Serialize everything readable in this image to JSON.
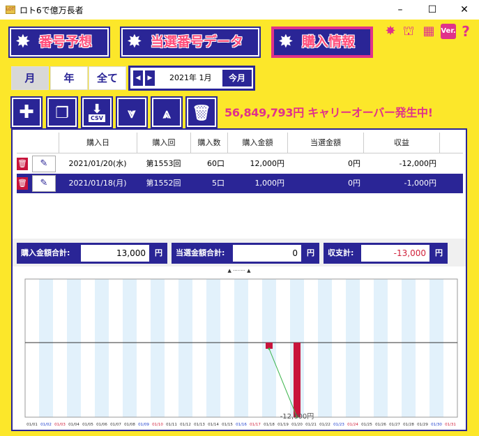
{
  "window": {
    "title": "ロト6で億万長者",
    "minimize": "–",
    "maximize": "☐",
    "close": "✕"
  },
  "nav": {
    "tabs": [
      {
        "label": "番号予想",
        "active": false
      },
      {
        "label": "当選番号データ",
        "active": false
      },
      {
        "label": "購入情報",
        "active": true
      }
    ],
    "version_label": "Ver.",
    "help_label": "?"
  },
  "period": {
    "buttons": [
      {
        "label": "月",
        "active": true
      },
      {
        "label": "年",
        "active": false
      },
      {
        "label": "全て",
        "active": false
      }
    ],
    "current": "2021年 1月",
    "today_label": "今月"
  },
  "toolbar": {
    "csv_label": "CSV",
    "carryover_text": "56,849,793円 キャリーオーバー発生中!"
  },
  "table": {
    "headers": [
      "購入日",
      "購入回",
      "購入数",
      "購入金額",
      "当選金額",
      "収益"
    ],
    "rows": [
      {
        "date": "2021/01/20(水)",
        "round": "第1553回",
        "count": "60口",
        "amount": "12,000円",
        "win": "0円",
        "profit": "-12,000円",
        "selected": false
      },
      {
        "date": "2021/01/18(月)",
        "round": "第1552回",
        "count": "5口",
        "amount": "1,000円",
        "win": "0円",
        "profit": "-1,000円",
        "selected": true
      }
    ]
  },
  "summary": {
    "purchase_label": "購入金額合計:",
    "purchase_value": "13,000",
    "win_label": "当選金額合計:",
    "win_value": "0",
    "balance_label": "収支計:",
    "balance_value": "-13,000",
    "unit": "円"
  },
  "splitter_label": "▲ ········ ▲",
  "colors": {
    "background": "#fce72a",
    "navy": "#2a2596",
    "pink": "#e0328a",
    "bar_red": "#c8143c",
    "weekday_blue": "#1a3ccc",
    "weekend_red": "#d0203a"
  },
  "chart_data": {
    "type": "bar",
    "x_labels": [
      "01/01",
      "01/02",
      "01/03",
      "01/04",
      "01/05",
      "01/06",
      "01/07",
      "01/08",
      "01/09",
      "01/10",
      "01/11",
      "01/12",
      "01/13",
      "01/14",
      "01/15",
      "01/16",
      "01/17",
      "01/18",
      "01/19",
      "01/20",
      "01/21",
      "01/22",
      "01/23",
      "01/24",
      "01/25",
      "01/26",
      "01/27",
      "01/28",
      "01/29",
      "01/30",
      "01/31"
    ],
    "x_label_colors": [
      "b",
      "s",
      "r",
      "b",
      "b",
      "b",
      "b",
      "b",
      "s",
      "r",
      "b",
      "b",
      "b",
      "b",
      "b",
      "s",
      "r",
      "b",
      "b",
      "b",
      "b",
      "b",
      "s",
      "r",
      "b",
      "b",
      "b",
      "b",
      "b",
      "s",
      "r"
    ],
    "values": [
      0,
      0,
      0,
      0,
      0,
      0,
      0,
      0,
      0,
      0,
      0,
      0,
      0,
      0,
      0,
      0,
      0,
      -1000,
      0,
      -12000,
      0,
      0,
      0,
      0,
      0,
      0,
      0,
      0,
      0,
      0,
      0
    ],
    "line_points": [
      {
        "x": "01/18",
        "y": -1000
      },
      {
        "x": "01/20",
        "y": -12000
      }
    ],
    "annotation": {
      "x": "01/20",
      "text": "-12,000円"
    },
    "ylim": [
      -12000,
      12000
    ]
  }
}
